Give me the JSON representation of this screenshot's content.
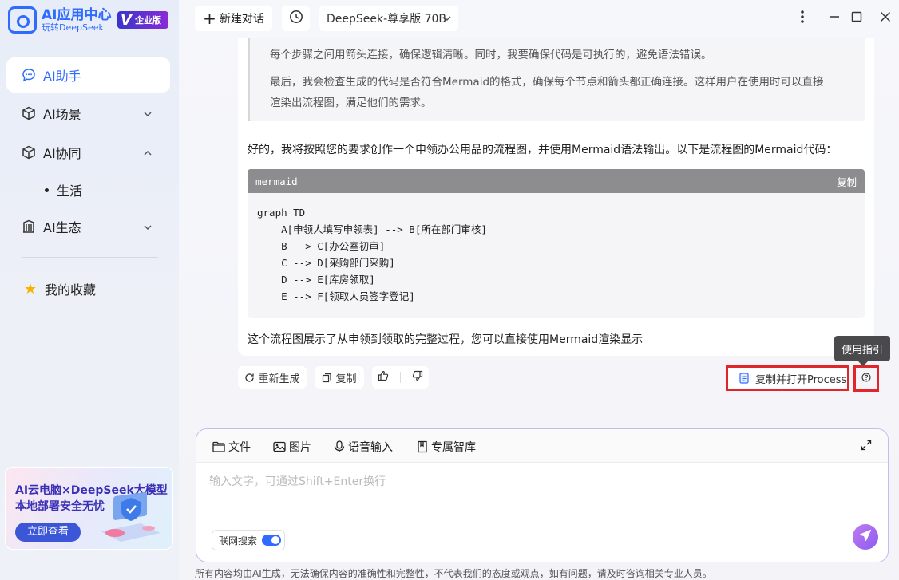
{
  "sidebar": {
    "logo": {
      "title": "AI应用中心",
      "subtitle": "玩转DeepSeek"
    },
    "badge": {
      "v": "V",
      "text": "企业版"
    },
    "items": [
      {
        "label": "AI助手"
      },
      {
        "label": "AI场景"
      },
      {
        "label": "AI协同"
      },
      {
        "label": "AI生态"
      }
    ],
    "sub_item": "生活",
    "favorites": "我的收藏",
    "promo": {
      "line1": "AI云电脑×DeepSeek大模型",
      "line2": "本地部署安全无忧",
      "button": "立即查看"
    }
  },
  "topbar": {
    "new_chat": "新建对话",
    "model": "DeepSeek-尊享版 70B"
  },
  "chat": {
    "quote_line1": "每个步骤之间用箭头连接，确保逻辑清晰。同时，我要确保代码是可执行的，避免语法错误。",
    "quote_line2": "最后，我会检查生成的代码是否符合Mermaid的格式，确保每个节点和箭头都正确连接。这样用户在使用时可以直接",
    "quote_line3": "渲染出流程图，满足他们的需求。",
    "intro": "好的，我将按照您的要求创作一个申领办公用品的流程图，并使用Mermaid语法输出。以下是流程图的Mermaid代码：",
    "code_lang": "mermaid",
    "code_copy": "复制",
    "code_lines": [
      "graph TD",
      "    A[申领人填写申领表] --> B[所在部门审核]",
      "    B --> C[办公室初审]",
      "    C --> D[采购部门采购]",
      "    D --> E[库房领取]",
      "    E --> F[领取人员签字登记]"
    ],
    "outro": "这个流程图展示了从申领到领取的完整过程，您可以直接使用Mermaid渲染显示"
  },
  "actions": {
    "regenerate": "重新生成",
    "copy": "复制",
    "processon": "复制并打开ProcessOn",
    "tooltip": "使用指引"
  },
  "input": {
    "tools": [
      "文件",
      "图片",
      "语音输入",
      "专属智库"
    ],
    "placeholder": "输入文字，可通过Shift+Enter换行",
    "web_search": "联网搜索",
    "web_search_on": true
  },
  "disclaimer": "所有内容均由AI生成，无法确保内容的准确性和完整性，不代表我们的态度或观点，如有问题，请及时咨询相关专业人员。",
  "colors": {
    "accent": "#2f6bff",
    "highlight": "#e1262b",
    "send": "#8a5cf0"
  }
}
